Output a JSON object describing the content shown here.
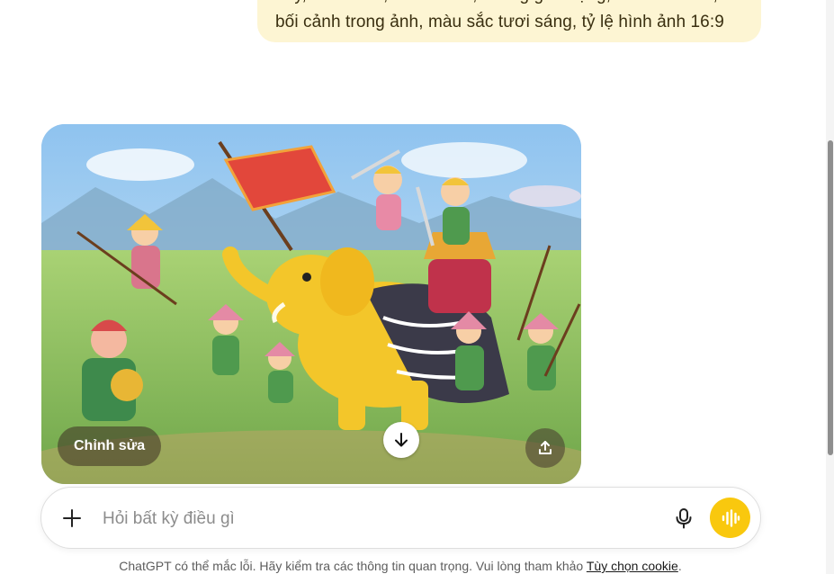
{
  "user_message": {
    "line1": "dày, tươi cười, màu nước, không gian rộng, nhiều chi tiết,",
    "line2": "bối cảnh trong ảnh, màu sắc tươi sáng, tỷ lệ hình ảnh 16:9"
  },
  "image_card": {
    "alt": "Tranh minh họa hoạt hình: đoàn binh lính tươi cười cầm giáo, cờ đỏ và người cưỡi voi vàng trên đồng cỏ",
    "edit_label": "Chỉnh sửa",
    "download_icon": "arrow-down-icon",
    "share_icon": "upload-icon"
  },
  "composer": {
    "placeholder": "Hỏi bất kỳ điều gì",
    "plus_icon": "plus-icon",
    "mic_icon": "microphone-icon",
    "voice_icon": "voice-waveform-icon",
    "voice_color": "#f9c80e"
  },
  "footer": {
    "disclaimer": "ChatGPT có thể mắc lỗi. Hãy kiểm tra các thông tin quan trọng. Vui lòng tham khảo",
    "cookie_link": "Tùy chọn cookie",
    "period": "."
  }
}
